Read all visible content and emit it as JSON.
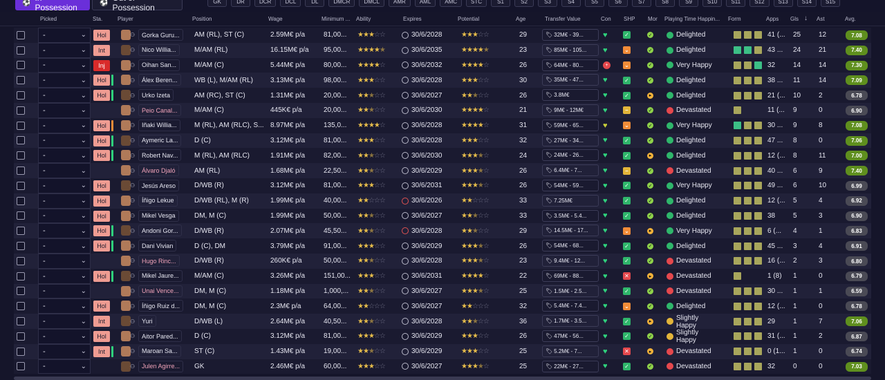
{
  "tabs": {
    "in_possession": "In Possession",
    "out_of_possession": "Out of Possession"
  },
  "positions": [
    "GK",
    "DR",
    "DCR",
    "DCL",
    "DL",
    "DMCR",
    "DMCL",
    "AMR",
    "AML",
    "AMC",
    "STC",
    "S1",
    "S2",
    "S3",
    "S4",
    "S5",
    "S6",
    "S7",
    "S8",
    "S9",
    "S10",
    "S11",
    "S12",
    "S13",
    "S14",
    "S15"
  ],
  "columns": {
    "picked": "Picked",
    "sta": "Sta.",
    "player": "Player",
    "position": "Position",
    "wage": "Wage",
    "minimum": "Minimum ...",
    "ability": "Ability",
    "expires": "Expires",
    "potential": "Potential",
    "age": "Age",
    "transfer_value": "Transfer Value",
    "con": "Con",
    "shp": "SHP",
    "mor": "Mor",
    "playing_time": "Playing Time Happin...",
    "form": "Form",
    "apps": "Apps",
    "gls": "Gls",
    "ast": "Ast",
    "avg": "Avg.",
    "sort_icon": "sort-down-arrow"
  },
  "colors": {
    "accent": "#6a2fd9",
    "green": "#2fd17c",
    "red": "#e5484d",
    "orange": "#f28c38",
    "star": "#e7bd4b",
    "form_green": "#3cbf86",
    "form_olive": "#a8a65c"
  },
  "rows": [
    {
      "picked": "-",
      "status": "Hol",
      "bar": "none",
      "name": "Gorka Guru...",
      "loan": false,
      "position": "AM (RL), ST (C)",
      "wage": "2.59M€ p/a",
      "minimum": "81,00...",
      "ability": 3,
      "expires": "30/6/2028",
      "exp_red": false,
      "potential": 3,
      "age": "29",
      "tv": "32M€ - 39...",
      "con": "green",
      "shp": "green",
      "mor": "green",
      "happy": "Delighted",
      "happy_color": "green",
      "form": [
        "o",
        "o",
        "o"
      ],
      "apps": "41 (...",
      "gls": "25",
      "ast": "12",
      "avg": "7.08",
      "avg_color": "green"
    },
    {
      "picked": "-",
      "status": "Int",
      "bar": "none",
      "name": "Nico Willia...",
      "loan": false,
      "position": "M/AM (RL)",
      "wage": "16.15M€ p/a",
      "minimum": "95,00...",
      "ability": 4.5,
      "expires": "30/6/2035",
      "exp_red": false,
      "potential": 4.5,
      "age": "23",
      "tv": "85M€ - 105...",
      "con": "green",
      "shp": "orange",
      "mor": "green",
      "happy": "Delighted",
      "happy_color": "green",
      "form": [
        "g",
        "g",
        "o"
      ],
      "apps": "43 ...",
      "gls": "24",
      "ast": "21",
      "avg": "7.40",
      "avg_color": "green"
    },
    {
      "picked": "-",
      "status": "Inj",
      "bar": "none",
      "name": "Oihan San...",
      "loan": false,
      "position": "M/AM (C)",
      "wage": "5.44M€ p/a",
      "minimum": "80,00...",
      "ability": 4,
      "expires": "30/6/2032",
      "exp_red": false,
      "potential": 4,
      "age": "26",
      "tv": "64M€ - 80...",
      "con": "redplus",
      "shp": "orange",
      "mor": "green",
      "happy": "Very Happy",
      "happy_color": "green",
      "form": [
        "o",
        "o",
        "g"
      ],
      "apps": "32",
      "gls": "14",
      "ast": "14",
      "avg": "7.30",
      "avg_color": "green"
    },
    {
      "picked": "-",
      "status": "Hol",
      "bar": "green",
      "name": "Álex Beren...",
      "loan": false,
      "position": "WB (L), M/AM (RL)",
      "wage": "3.13M€ p/a",
      "minimum": "98,00...",
      "ability": 3,
      "expires": "30/6/2028",
      "exp_red": false,
      "potential": 3,
      "age": "30",
      "tv": "35M€ - 47...",
      "con": "green",
      "shp": "green",
      "mor": "green",
      "happy": "Delighted",
      "happy_color": "green",
      "form": [
        "o",
        "o",
        "o"
      ],
      "apps": "38 ...",
      "gls": "11",
      "ast": "14",
      "avg": "7.09",
      "avg_color": "green"
    },
    {
      "picked": "-",
      "status": "Hol",
      "bar": "green",
      "name": "Urko Izeta",
      "loan": false,
      "position": "AM (RC), ST (C)",
      "wage": "1.31M€ p/a",
      "minimum": "20,00...",
      "ability": 2.5,
      "expires": "30/6/2027",
      "exp_red": false,
      "potential": 2.5,
      "age": "26",
      "tv": "3.8M€",
      "con": "green",
      "shp": "green",
      "mor": "orange",
      "happy": "Delighted",
      "happy_color": "green",
      "form": [
        "o",
        "o",
        "o"
      ],
      "apps": "21 (...",
      "gls": "10",
      "ast": "2",
      "avg": "6.78",
      "avg_color": "gray"
    },
    {
      "picked": "-",
      "status": "",
      "bar": "none",
      "name": "Peio Canal...",
      "loan": true,
      "position": "M/AM (C)",
      "wage": "445K€ p/a",
      "minimum": "20,00...",
      "ability": 2.5,
      "expires": "30/6/2030",
      "exp_red": false,
      "potential": 4,
      "age": "21",
      "tv": "9M€ - 12M€",
      "con": "green",
      "shp": "yellow",
      "mor": "green",
      "happy": "Devastated",
      "happy_color": "red",
      "form": [
        "o"
      ],
      "apps": "11 (...",
      "gls": "9",
      "ast": "0",
      "avg": "6.90",
      "avg_color": "gray"
    },
    {
      "picked": "-",
      "status": "Hol",
      "bar": "orange",
      "name": "Iñaki Willia...",
      "loan": false,
      "position": "M (RL), AM (RLC), S...",
      "wage": "8.97M€ p/a",
      "minimum": "135,0...",
      "ability": 4,
      "expires": "30/6/2028",
      "exp_red": false,
      "potential": 4,
      "age": "31",
      "tv": "59M€ - 65...",
      "con": "yellow",
      "shp": "orange",
      "mor": "green",
      "happy": "Very Happy",
      "happy_color": "green",
      "form": [
        "g",
        "o",
        "o"
      ],
      "apps": "30 ...",
      "gls": "9",
      "ast": "8",
      "avg": "7.08",
      "avg_color": "green"
    },
    {
      "picked": "-",
      "status": "Hol",
      "bar": "green",
      "name": "Aymeric La...",
      "loan": false,
      "position": "D (C)",
      "wage": "3.12M€ p/a",
      "minimum": "81,00...",
      "ability": 3,
      "expires": "30/6/2028",
      "exp_red": false,
      "potential": 3,
      "age": "32",
      "tv": "27M€ - 34...",
      "con": "green",
      "shp": "green",
      "mor": "green",
      "happy": "Delighted",
      "happy_color": "green",
      "form": [
        "o",
        "o",
        "o"
      ],
      "apps": "47 ...",
      "gls": "8",
      "ast": "0",
      "avg": "7.06",
      "avg_color": "green"
    },
    {
      "picked": "-",
      "status": "Hol",
      "bar": "green",
      "name": "Robert Nav...",
      "loan": false,
      "position": "M (RL), AM (RLC)",
      "wage": "1.91M€ p/a",
      "minimum": "82,00...",
      "ability": 2.5,
      "expires": "30/6/2030",
      "exp_red": false,
      "potential": 3.5,
      "age": "24",
      "tv": "24M€ - 26...",
      "con": "green",
      "shp": "green",
      "mor": "orange",
      "happy": "Delighted",
      "happy_color": "green",
      "form": [
        "o",
        "o",
        "o"
      ],
      "apps": "12 (...",
      "gls": "8",
      "ast": "11",
      "avg": "7.00",
      "avg_color": "green"
    },
    {
      "picked": "-",
      "status": "",
      "bar": "none",
      "name": "Álvaro Djaló",
      "loan": true,
      "position": "AM (RL)",
      "wage": "1.68M€ p/a",
      "minimum": "22,50...",
      "ability": 2.5,
      "expires": "30/6/2029",
      "exp_red": false,
      "potential": 3.5,
      "age": "26",
      "tv": "6.4M€ - 7...",
      "con": "green",
      "shp": "yellow",
      "mor": "green",
      "happy": "Devastated",
      "happy_color": "red",
      "form": [
        "o",
        "o",
        "o"
      ],
      "apps": "40 ...",
      "gls": "6",
      "ast": "9",
      "avg": "7.40",
      "avg_color": "green"
    },
    {
      "picked": "-",
      "status": "Hol",
      "bar": "none",
      "name": "Jesús Areso",
      "loan": false,
      "position": "D/WB (R)",
      "wage": "3.12M€ p/a",
      "minimum": "81,00...",
      "ability": 3,
      "expires": "30/6/2031",
      "exp_red": false,
      "potential": 3.5,
      "age": "26",
      "tv": "54M€ - 59...",
      "con": "green",
      "shp": "green",
      "mor": "green",
      "happy": "Very Happy",
      "happy_color": "green",
      "form": [
        "o",
        "o",
        "o"
      ],
      "apps": "49 ...",
      "gls": "6",
      "ast": "10",
      "avg": "6.99",
      "avg_color": "gray"
    },
    {
      "picked": "-",
      "status": "Hol",
      "bar": "none",
      "name": "Íñigo Lekue",
      "loan": false,
      "position": "D/WB (RL), M (R)",
      "wage": "1.99M€ p/a",
      "minimum": "40,00...",
      "ability": 2,
      "expires": "30/6/2026",
      "exp_red": true,
      "potential": 2,
      "age": "33",
      "tv": "7.25M€",
      "con": "green",
      "shp": "green",
      "mor": "green",
      "happy": "Delighted",
      "happy_color": "green",
      "form": [
        "o",
        "o",
        "o"
      ],
      "apps": "12 (...",
      "gls": "5",
      "ast": "4",
      "avg": "6.92",
      "avg_color": "gray"
    },
    {
      "picked": "-",
      "status": "Hol",
      "bar": "none",
      "name": "Mikel Vesga",
      "loan": false,
      "position": "DM, M (C)",
      "wage": "1.99M€ p/a",
      "minimum": "50,00...",
      "ability": 2.5,
      "expires": "30/6/2027",
      "exp_red": false,
      "potential": 2.5,
      "age": "33",
      "tv": "3.5M€ - 5.4...",
      "con": "green",
      "shp": "green",
      "mor": "green",
      "happy": "Delighted",
      "happy_color": "green",
      "form": [
        "o",
        "o",
        "o"
      ],
      "apps": "38",
      "gls": "5",
      "ast": "3",
      "avg": "6.90",
      "avg_color": "gray"
    },
    {
      "picked": "-",
      "status": "Hol",
      "bar": "green",
      "name": "Andoni Gor...",
      "loan": false,
      "position": "D/WB (R)",
      "wage": "2.07M€ p/a",
      "minimum": "45,50...",
      "ability": 2.5,
      "expires": "30/6/2028",
      "exp_red": true,
      "potential": 2.5,
      "age": "29",
      "tv": "14.5M€ - 17...",
      "con": "green",
      "shp": "orange",
      "mor": "orange",
      "happy": "Very Happy",
      "happy_color": "green",
      "form": [
        "o",
        "o",
        "o"
      ],
      "apps": "6 (...",
      "gls": "4",
      "ast": "1",
      "avg": "6.83",
      "avg_color": "gray"
    },
    {
      "picked": "-",
      "status": "Hol",
      "bar": "green",
      "name": "Dani Vivian",
      "loan": false,
      "position": "D (C), DM",
      "wage": "3.79M€ p/a",
      "minimum": "91,00...",
      "ability": 3,
      "expires": "30/6/2029",
      "exp_red": false,
      "potential": 3.5,
      "age": "26",
      "tv": "54M€ - 68...",
      "con": "green",
      "shp": "green",
      "mor": "green",
      "happy": "Delighted",
      "happy_color": "green",
      "form": [
        "o",
        "o",
        "o"
      ],
      "apps": "45 ...",
      "gls": "3",
      "ast": "4",
      "avg": "6.91",
      "avg_color": "gray"
    },
    {
      "picked": "-",
      "status": "",
      "bar": "none",
      "name": "Hugo Rinc...",
      "loan": true,
      "position": "D/WB (R)",
      "wage": "260K€ p/a",
      "minimum": "50,00...",
      "ability": 2.5,
      "expires": "30/6/2028",
      "exp_red": false,
      "potential": 3.5,
      "age": "23",
      "tv": "9.4M€ - 12...",
      "con": "green",
      "shp": "green",
      "mor": "green",
      "happy": "Devastated",
      "happy_color": "red",
      "form": [
        "o",
        "o",
        "o"
      ],
      "apps": "16 (...",
      "gls": "2",
      "ast": "3",
      "avg": "6.80",
      "avg_color": "gray"
    },
    {
      "picked": "-",
      "status": "Hol",
      "bar": "green",
      "name": "Mikel Jaure...",
      "loan": false,
      "position": "M/AM (C)",
      "wage": "3.26M€ p/a",
      "minimum": "151,00...",
      "ability": 3,
      "expires": "30/6/2031",
      "exp_red": false,
      "potential": 4,
      "age": "22",
      "tv": "69M€ - 88...",
      "con": "green",
      "shp": "redx",
      "mor": "orange",
      "happy": "Devastated",
      "happy_color": "red",
      "form": [
        "o"
      ],
      "apps": "1 (8)",
      "gls": "1",
      "ast": "0",
      "avg": "6.79",
      "avg_color": "gray"
    },
    {
      "picked": "-",
      "status": "",
      "bar": "none",
      "name": "Unai Vence...",
      "loan": true,
      "position": "DM, M (C)",
      "wage": "1.18M€ p/a",
      "minimum": "1,000,...",
      "ability": 2.5,
      "expires": "30/6/2027",
      "exp_red": false,
      "potential": 3.5,
      "age": "25",
      "tv": "1.5M€ - 2.5...",
      "con": "green",
      "shp": "green",
      "mor": "green",
      "happy": "Devastated",
      "happy_color": "red",
      "form": [
        "o",
        "o",
        "o"
      ],
      "apps": "30 ...",
      "gls": "1",
      "ast": "1",
      "avg": "6.59",
      "avg_color": "gray"
    },
    {
      "picked": "-",
      "status": "Hol",
      "bar": "none",
      "name": "Íñigo Ruiz d...",
      "loan": false,
      "position": "DM, M (C)",
      "wage": "2.3M€ p/a",
      "minimum": "64,00...",
      "ability": 2,
      "expires": "30/6/2027",
      "exp_red": false,
      "potential": 2,
      "age": "32",
      "tv": "5.4M€ - 7.4...",
      "con": "green",
      "shp": "orange",
      "mor": "green",
      "happy": "Delighted",
      "happy_color": "green",
      "form": [
        "o",
        "o",
        "o"
      ],
      "apps": "12 (...",
      "gls": "1",
      "ast": "0",
      "avg": "6.78",
      "avg_color": "gray"
    },
    {
      "picked": "-",
      "status": "Int",
      "bar": "none",
      "name": "Yuri",
      "loan": false,
      "position": "D/WB (L)",
      "wage": "2.64M€ p/a",
      "minimum": "40,50...",
      "ability": 2.5,
      "expires": "30/6/2028",
      "exp_red": false,
      "potential": 2.5,
      "age": "36",
      "tv": "1.7M€ - 3.5...",
      "con": "green",
      "shp": "green",
      "mor": "orange",
      "happy": "Slightly Happy",
      "happy_color": "yellow",
      "form": [
        "o",
        "o",
        "o"
      ],
      "apps": "29",
      "gls": "1",
      "ast": "7",
      "avg": "7.06",
      "avg_color": "green"
    },
    {
      "picked": "-",
      "status": "Hol",
      "bar": "none",
      "name": "Aitor Pared...",
      "loan": false,
      "position": "D (C)",
      "wage": "3.12M€ p/a",
      "minimum": "81,00...",
      "ability": 3,
      "expires": "30/6/2029",
      "exp_red": false,
      "potential": 3,
      "age": "26",
      "tv": "47M€ - 56...",
      "con": "green",
      "shp": "green",
      "mor": "green",
      "happy": "Slightly Happy",
      "happy_color": "yellow",
      "form": [
        "o",
        "o",
        "o"
      ],
      "apps": "31 (...",
      "gls": "1",
      "ast": "2",
      "avg": "6.87",
      "avg_color": "gray"
    },
    {
      "picked": "-",
      "status": "Int",
      "bar": "green",
      "name": "Maroan Sa...",
      "loan": false,
      "position": "ST (C)",
      "wage": "1.43M€ p/a",
      "minimum": "19,00...",
      "ability": 2.5,
      "expires": "30/6/2029",
      "exp_red": false,
      "potential": 3,
      "age": "25",
      "tv": "5.2M€ - 7...",
      "con": "green",
      "shp": "redx",
      "mor": "orange",
      "happy": "Devastated",
      "happy_color": "red",
      "form": [
        "o",
        "o",
        "o"
      ],
      "apps": "0 (1...",
      "gls": "1",
      "ast": "0",
      "avg": "6.74",
      "avg_color": "gray"
    },
    {
      "picked": "-",
      "status": "",
      "bar": "none",
      "name": "Julen Agirre...",
      "loan": true,
      "position": "GK",
      "wage": "2.46M€ p/a",
      "minimum": "60,00...",
      "ability": 3,
      "expires": "30/6/2027",
      "exp_red": false,
      "potential": 3.5,
      "age": "25",
      "tv": "22M€ - 27...",
      "con": "green",
      "shp": "green",
      "mor": "green",
      "happy": "Devastated",
      "happy_color": "red",
      "form": [
        "o",
        "o",
        "o"
      ],
      "apps": "32",
      "gls": "0",
      "ast": "0",
      "avg": "7.03",
      "avg_color": "green"
    }
  ]
}
